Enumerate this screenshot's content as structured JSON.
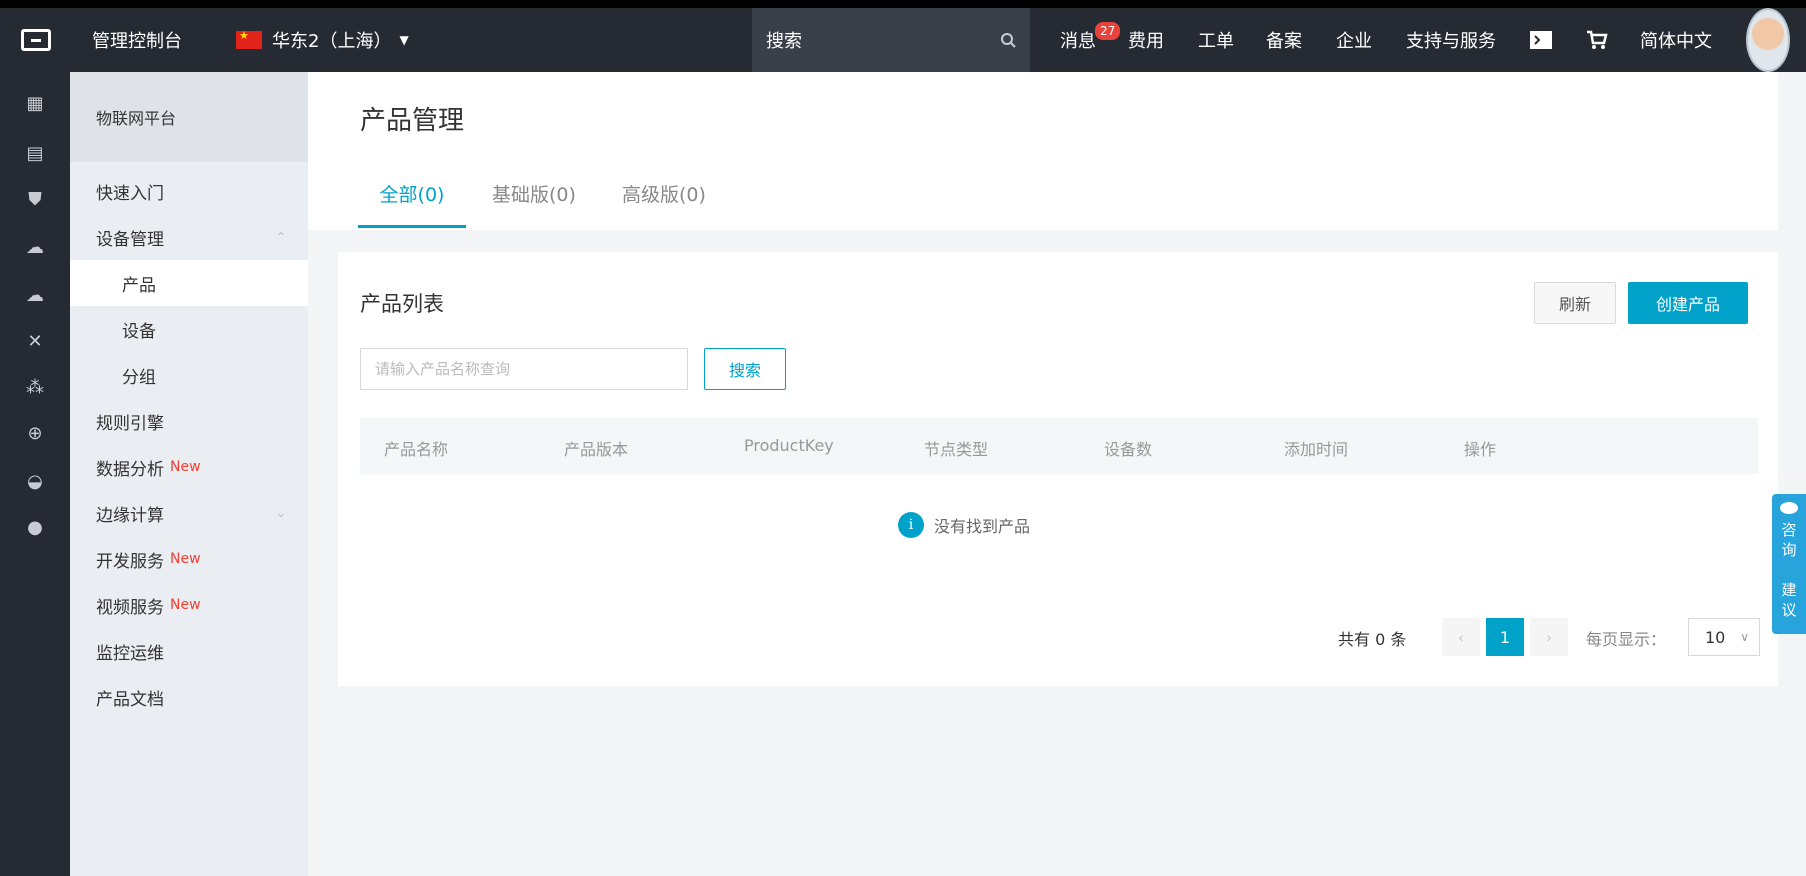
{
  "topbar": {
    "console": "管理控制台",
    "region": "华东2（上海）",
    "search_placeholder": "搜索",
    "messages": "消息",
    "messages_badge": "27",
    "nav": [
      "费用",
      "工单",
      "备案",
      "企业",
      "支持与服务"
    ],
    "language": "简体中文"
  },
  "rail_icons": [
    "grid-icon",
    "server-icon",
    "shield-icon",
    "cloud-icon",
    "cloud-upload-icon",
    "tools-icon",
    "network-icon",
    "globe-icon",
    "apple-icon",
    "circle-icon"
  ],
  "sidebar": {
    "header": "物联网平台",
    "items": [
      {
        "label": "快速入门",
        "level": 1
      },
      {
        "label": "设备管理",
        "level": 1
      },
      {
        "label": "产品",
        "level": 2
      },
      {
        "label": "设备",
        "level": 2
      },
      {
        "label": "分组",
        "level": 2
      },
      {
        "label": "规则引擎",
        "level": 1
      },
      {
        "label": "数据分析",
        "level": 1,
        "badge": "New"
      },
      {
        "label": "边缘计算",
        "level": 1
      },
      {
        "label": "开发服务",
        "level": 1,
        "badge": "New"
      },
      {
        "label": "视频服务",
        "level": 1,
        "badge": "New"
      },
      {
        "label": "监控运维",
        "level": 1
      },
      {
        "label": "产品文档",
        "level": 1
      }
    ]
  },
  "main": {
    "title": "产品管理",
    "tabs": [
      "全部(0)",
      "基础版(0)",
      "高级版(0)"
    ],
    "card_title": "产品列表",
    "refresh": "刷新",
    "create": "创建产品",
    "search_placeholder": "请输入产品名称查询",
    "search_button": "搜索",
    "columns": [
      "产品名称",
      "产品版本",
      "ProductKey",
      "节点类型",
      "设备数",
      "添加时间",
      "操作"
    ],
    "empty": "没有找到产品",
    "total": "共有 0 条",
    "page": "1",
    "per_page_label": "每页显示：",
    "per_page": "10"
  },
  "floattab": [
    "咨",
    "询",
    "·",
    "建",
    "议"
  ],
  "colors": {
    "accent": "#00a2ca",
    "topbar": "#262b33",
    "badge": "#e8423b",
    "new": "#f04134"
  }
}
